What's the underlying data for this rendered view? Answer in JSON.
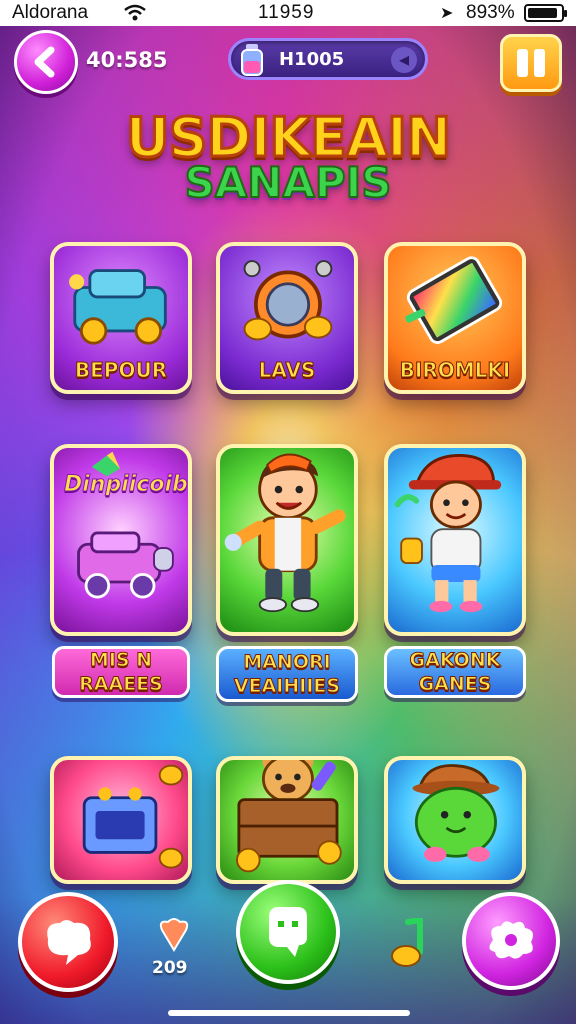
{
  "status_bar": {
    "carrier": "Aldorana",
    "time": "11959",
    "battery_percent_text": "893%",
    "battery_level": 0.92,
    "icons": [
      "wifi-icon",
      "location-icon",
      "battery-icon"
    ]
  },
  "header": {
    "timer_text": "40:585",
    "coin_pill_text": "H1005",
    "icons": [
      "back-arrow-icon",
      "potion-icon",
      "pause-icon"
    ]
  },
  "title": {
    "main": "USDIKEAIN",
    "sub": "SANAPIS"
  },
  "tiles": [
    {
      "label": "BEPOUR",
      "art": "car-icon"
    },
    {
      "label": "LAVS",
      "art": "mirror-icon"
    },
    {
      "label": "BIROMLKI",
      "art": "tablet-icon"
    },
    {
      "art_text": "Dinpiicoib",
      "label_line1": "MIS N",
      "label_line2": "RAAEES",
      "art": "toy-car-icon"
    },
    {
      "label_line1": "MANORI",
      "label_line2": "VEAIHIIES",
      "art": "boy-character"
    },
    {
      "label_line1": "GAKONK",
      "label_line2": "GANES",
      "art": "kid-character"
    },
    {
      "art": "gift-box-icon"
    },
    {
      "art": "bear-treasure-chest"
    },
    {
      "art": "green-blob-character"
    }
  ],
  "bottom": {
    "gem_count": "209",
    "icons": [
      "chat-icon",
      "play-icon",
      "settings-icon",
      "gem-icon",
      "music-note-icon"
    ]
  },
  "colors": {
    "title_gold": "#ffd21c",
    "title_green": "#3cd44c",
    "accent_purple": "#d020d8",
    "accent_orange": "#ff9a12"
  }
}
